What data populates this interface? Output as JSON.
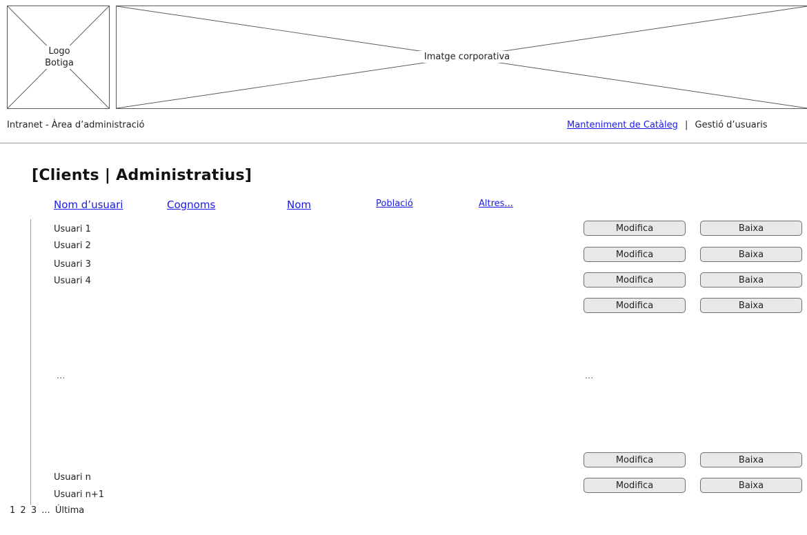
{
  "header": {
    "logo_label": "Logo\nBotiga",
    "banner_label": "Imatge corporativa"
  },
  "topbar": {
    "area_title": "Intranet - Àrea d’administració",
    "nav_catalog": "Manteniment de Catàleg",
    "separator": "|",
    "nav_users": "Gestió d’usuaris"
  },
  "page": {
    "title": "[Clients | Administratius]"
  },
  "columns": {
    "username": "Nom d’usuari",
    "surnames": "Cognoms",
    "name": "Nom",
    "city": "Població",
    "others": "Altres..."
  },
  "users": [
    "Usuari 1",
    "Usuari 2",
    "Usuari 3",
    "Usuari 4",
    "Usuari n",
    "Usuari n+1"
  ],
  "ellipsis": "...",
  "buttons": {
    "modify": "Modifica",
    "delete": "Baixa"
  },
  "pagination": {
    "pages": [
      "1",
      "2",
      "3"
    ],
    "ellipsis": "...",
    "last": "Última"
  }
}
